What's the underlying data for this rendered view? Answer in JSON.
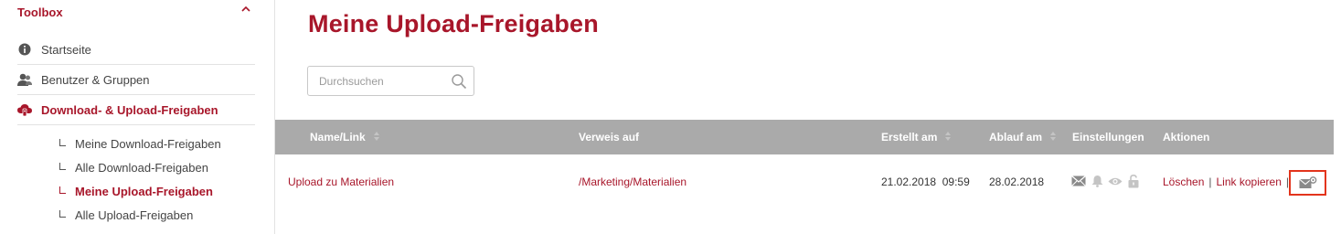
{
  "sidebar": {
    "title": "Toolbox",
    "items": [
      {
        "label": "Startseite",
        "icon": "info-icon"
      },
      {
        "label": "Benutzer & Gruppen",
        "icon": "users-icon"
      },
      {
        "label": "Download- & Upload-Freigaben",
        "icon": "cloud-share-icon",
        "active": true
      }
    ],
    "subitems": [
      {
        "label": "Meine Download-Freigaben"
      },
      {
        "label": "Alle Download-Freigaben"
      },
      {
        "label": "Meine Upload-Freigaben",
        "active": true
      },
      {
        "label": "Alle Upload-Freigaben"
      }
    ]
  },
  "main": {
    "title": "Meine Upload-Freigaben",
    "search": {
      "placeholder": "Durchsuchen",
      "value": ""
    },
    "table": {
      "columns": [
        "Name/Link",
        "Verweis auf",
        "Erstellt am",
        "Ablauf am",
        "Einstellungen",
        "Aktionen"
      ],
      "rows": [
        {
          "name": "Upload zu Materialien",
          "target": "/Marketing/Materialien",
          "created": "21.02.2018  09:59",
          "expires": "28.02.2018",
          "settings_icons": [
            "mail-icon",
            "bell-icon",
            "eye-icon",
            "unlock-icon"
          ],
          "actions": [
            "Löschen",
            "Link kopieren"
          ],
          "extra_action_icon": "mail-settings-icon"
        }
      ]
    }
  },
  "colors": {
    "accent": "#a8162a",
    "header_bg": "#aaaaaa",
    "highlight": "#e3341c",
    "icon_gray": "#9a9a9a"
  }
}
